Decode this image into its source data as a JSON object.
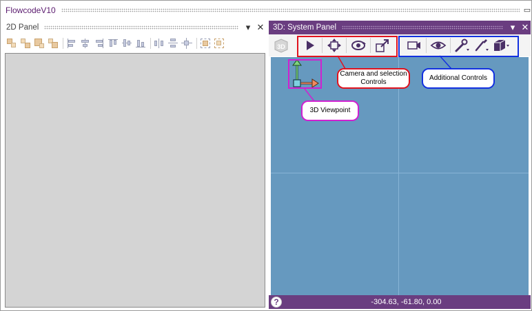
{
  "app": {
    "title": "FlowcodeV10"
  },
  "panel_2d": {
    "title": "2D Panel",
    "toolbar_icons": [
      "align-icon-1",
      "align-icon-2",
      "align-icon-3",
      "align-icon-4",
      "align-left-icon",
      "align-center-icon",
      "align-right-icon",
      "align-top-icon",
      "align-middle-icon",
      "align-bottom-icon",
      "distribute-h-icon",
      "distribute-v-icon",
      "center-icon",
      "group-icon",
      "ungroup-icon"
    ]
  },
  "panel_3d": {
    "title": "3D: System Panel",
    "toolbar": {
      "view_3d_button": "3D",
      "camera_icons": [
        "pointer-icon",
        "pan-icon",
        "orbit-icon",
        "zoom-icon"
      ],
      "additional_icons": [
        "camera-icon",
        "eye-icon",
        "wrench-icon",
        "brush-icon",
        "cube-icon"
      ]
    },
    "status": {
      "help": "?",
      "coordinates": "-304.63, -61.80, 0.00"
    }
  },
  "annotations": {
    "camera_controls": "Camera and selection Controls",
    "additional_controls": "Additional Controls",
    "viewpoint": "3D Viewpoint"
  },
  "colors": {
    "panel_header": "#6a3d80",
    "viewport": "#6699bf",
    "canvas_2d": "#d4d4d4",
    "camera_group": "#e0121e",
    "additional_group": "#1230e0",
    "viewpoint_group": "#d020d0"
  }
}
